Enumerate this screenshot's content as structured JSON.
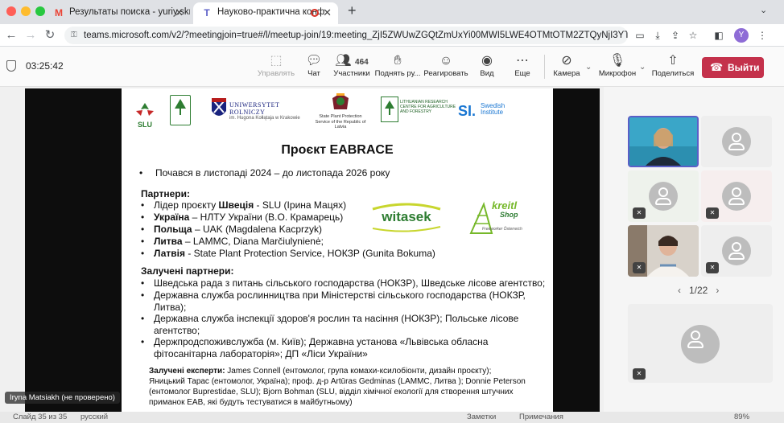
{
  "browser": {
    "tabs": [
      {
        "title": "Результаты поиска - yuriy.skr",
        "favicon": "gmail-icon"
      },
      {
        "title": "Науково-практична конф",
        "favicon": "teams-icon"
      }
    ],
    "url": "teams.microsoft.com/v2/?meetingjoin=true#/l/meetup-join/19:meeting_ZjI5ZWUwZGQtZmUxYi00MWI5LWE4OTMtOTM2ZTQyNjI3YT...",
    "profile_initial": "Y"
  },
  "toolbar": {
    "timer": "03:25:42",
    "control_label": "Управлять",
    "chat_label": "Чат",
    "participants_count": "464",
    "participants_label": "Участники",
    "raise_label": "Поднять ру...",
    "react_label": "Реагировать",
    "view_label": "Вид",
    "more_label": "Еще",
    "camera_label": "Камера",
    "mic_label": "Микрофон",
    "share_label": "Поделиться",
    "leave_label": "Выйти"
  },
  "slide": {
    "logos": {
      "slu": "SLU",
      "rolniczy": "UNIWERSYTET ROLNICZY",
      "rolniczy_sub": "im. Hugona Kołłątaja w Krakowie",
      "latvia": "State Plant Protection Service of the Republic of Latvia",
      "lammc": "LITHUANIAN RESEARCH CENTRE FOR AGRICULTURE AND FORESTRY",
      "swedish": "Swedish Institute",
      "swedish_mark": "SI."
    },
    "title": "Проєкт EABRACE",
    "started": "Почався в листопаді 2024 – до листопада 2026 року",
    "partners_heading": "Партнери:",
    "partners": [
      {
        "pre": "Лідер проєкту ",
        "bold": "Швеція",
        "rest": "  - SLU (Ірина Мацях)"
      },
      {
        "pre": "",
        "bold": "Україна",
        "rest": " – НЛТУ України (В.О. Крамарець)"
      },
      {
        "pre": "",
        "bold": "Польща",
        "rest": " – UAK (Magdalena Kacprzyk)"
      },
      {
        "pre": "",
        "bold": "Литва",
        "rest": " – LAMMC, Diana Marčiulynienė;"
      },
      {
        "pre": "",
        "bold": "Латвія",
        "rest": " - State Plant Protection Service, НОКЗР (Gunita Bokuma)"
      }
    ],
    "sponsor_witasek": "witasek",
    "sponsor_kreitl": "kreitl",
    "sponsor_kreitl_sub": "Shop",
    "sponsor_kreitl_tag": "Freeworker Österreich",
    "involved_heading": "Залучені партнери:",
    "involved": [
      "Шведська рада з питань сільського господарства (НОКЗР), Шведське лісове агентство;",
      "Державна служба рослинництва при Міністерстві сільського господарства (НОКЗР,",
      "Литва);",
      "Державна служба інспекції здоров'я рослин та насіння (НОКЗР); Польське лісове",
      "агентство;",
      "Держпродспоживслужба (м. Київ); Державна установа «Львівська обласна",
      "фітосанітарна лабораторія»; ДП «Ліси України»"
    ],
    "experts_heading": "Залучені експерти:",
    "experts_lines": [
      " James Connell (ентомолог, група комахи-ксилобіонти, дизайн проєкту);",
      "Яницький Тарас (ентомолог, Україна); проф. д-р Artūras Gedminas (LAMMC, Литва ); Donnie Peterson",
      "(ентомолог Buprestidae, SLU); Bjorn Bohman (SLU, відділ хімічної екології для створення штучних",
      "приманок ЕАВ, які будуть тестуватися в майбутньому)"
    ]
  },
  "presenter_name": "Iryna Matsiakh (не проверено)",
  "pager": "1/22",
  "statusbar": {
    "slide": "Слайд 35 из 35",
    "lang": "русский",
    "notes": "Заметки",
    "comments": "Примечания",
    "zoom": "89%"
  }
}
